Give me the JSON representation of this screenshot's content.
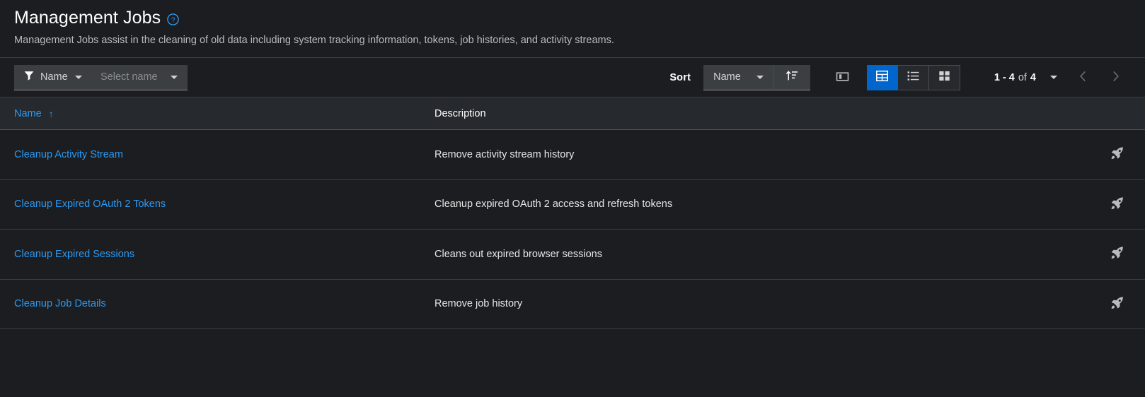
{
  "header": {
    "title": "Management Jobs",
    "help_icon": "question-circle-icon",
    "subtitle": "Management Jobs assist in the cleaning of old data including system tracking information, tokens, job histories, and activity streams."
  },
  "toolbar": {
    "filter_icon": "filter-icon",
    "filter_attribute": "Name",
    "filter_value_placeholder": "Select name",
    "sort_label": "Sort",
    "sort_field": "Name",
    "sort_direction_icon": "sort-amount-up-icon",
    "column_management_icon": "column-management-icon",
    "view_toggles": [
      {
        "icon": "table-view-icon",
        "name": "table-view",
        "active": true
      },
      {
        "icon": "list-view-icon",
        "name": "list-view",
        "active": false
      },
      {
        "icon": "card-view-icon",
        "name": "card-view",
        "active": false
      }
    ],
    "pagination": {
      "range": "1 - 4",
      "of_label": "of",
      "total": "4",
      "per_page_caret": "chevron-down-icon",
      "prev_icon": "chevron-left-icon",
      "next_icon": "chevron-right-icon"
    }
  },
  "table": {
    "columns": [
      {
        "label": "Name",
        "sortable": true,
        "sort_indicator": "↑"
      },
      {
        "label": "Description",
        "sortable": false
      }
    ],
    "rows": [
      {
        "name": "Cleanup Activity Stream",
        "description": "Remove activity stream history",
        "action_icon": "rocket-icon"
      },
      {
        "name": "Cleanup Expired OAuth 2 Tokens",
        "description": "Cleanup expired OAuth 2 access and refresh tokens",
        "action_icon": "rocket-icon"
      },
      {
        "name": "Cleanup Expired Sessions",
        "description": "Cleans out expired browser sessions",
        "action_icon": "rocket-icon"
      },
      {
        "name": "Cleanup Job Details",
        "description": "Remove job history",
        "action_icon": "rocket-icon"
      }
    ]
  },
  "colors": {
    "background": "#1b1d21",
    "header_row_background": "#26292d",
    "link": "#2b9af3",
    "accent_active": "#0066cc",
    "control_background": "#3c3f42",
    "muted_text": "#b8bbbe",
    "border": "#3c3f42"
  }
}
